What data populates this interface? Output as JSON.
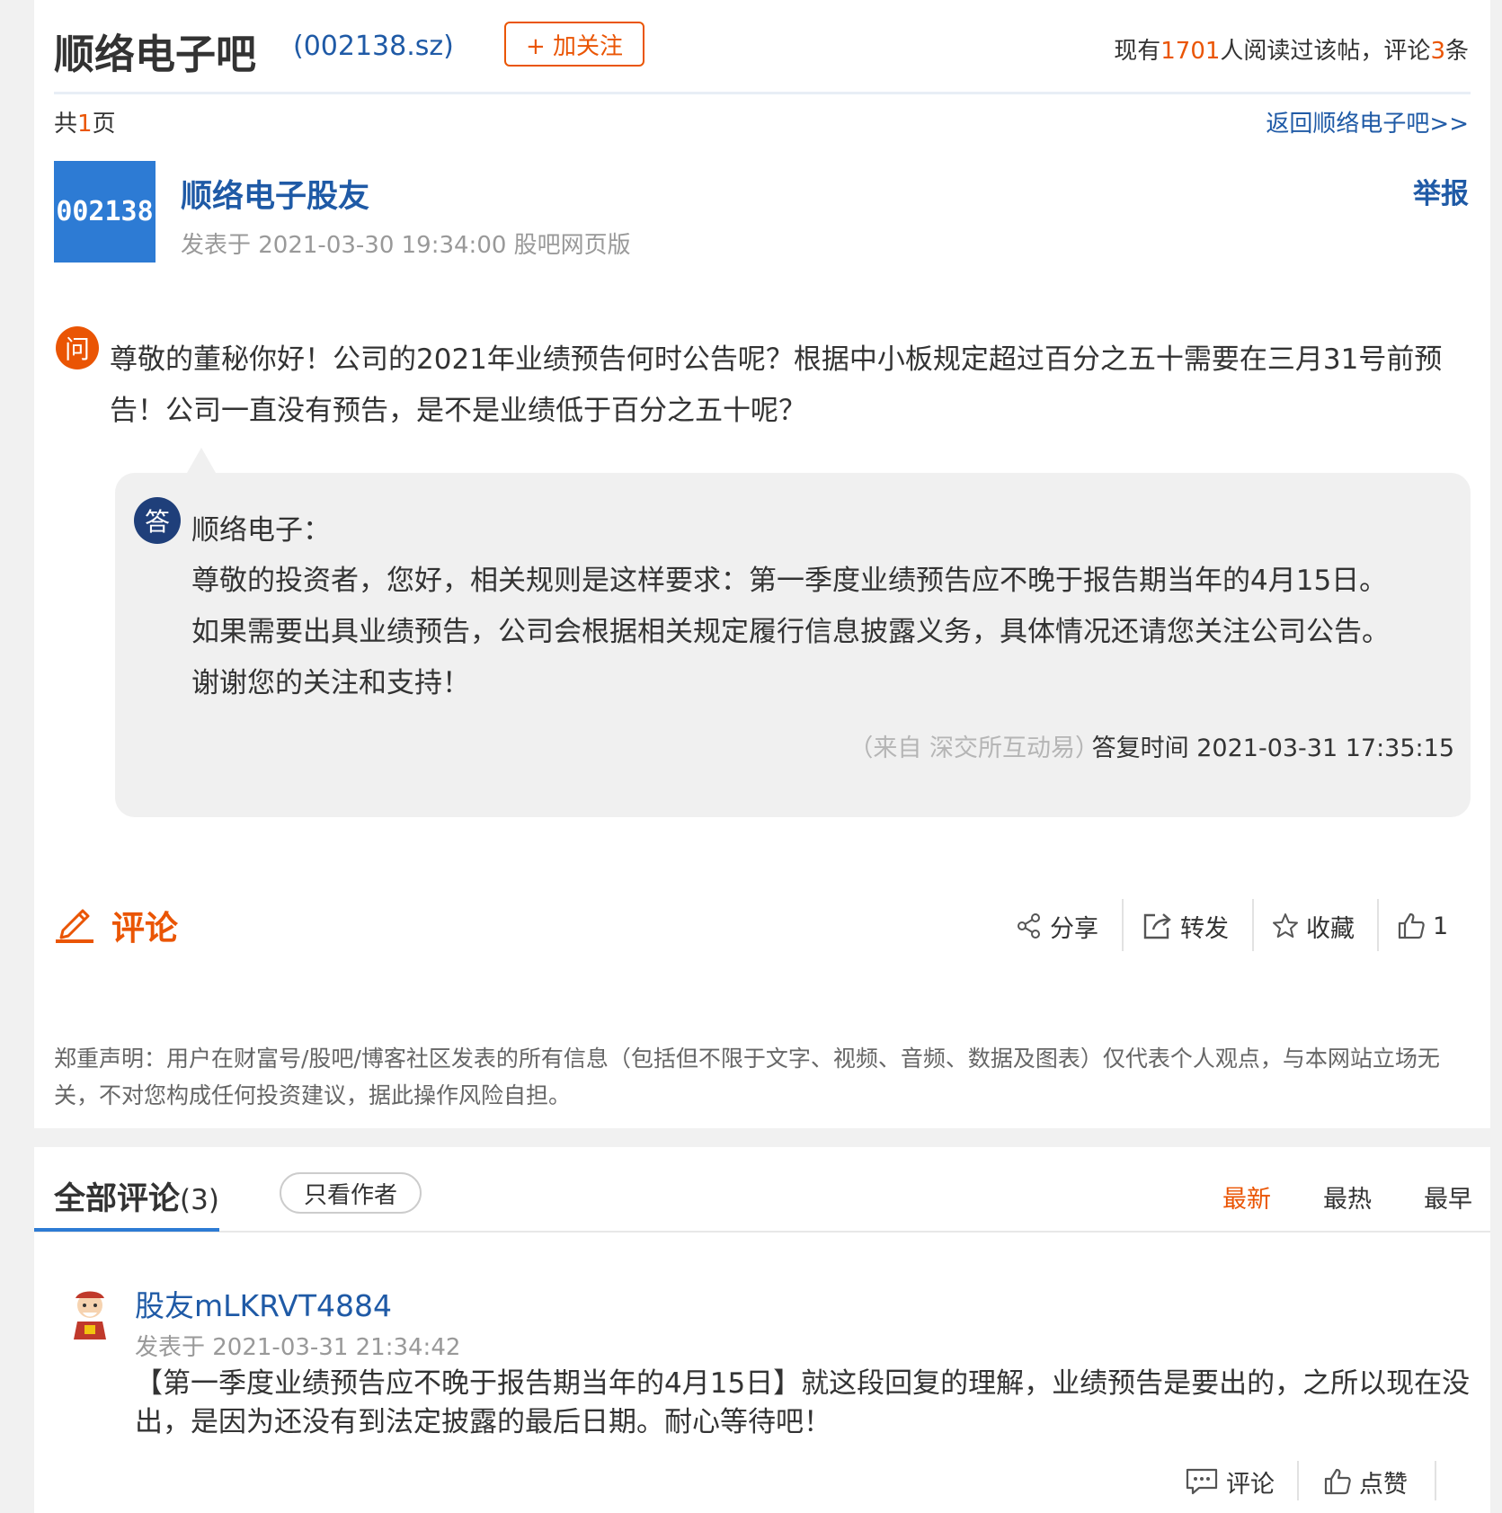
{
  "header": {
    "bar_name": "顺络电子吧",
    "stock_code": "(002138.sz)",
    "follow_label": "+ 加关注",
    "stats_prefix": "现有",
    "read_count": "1701",
    "stats_mid": "人阅读过该帖，评论",
    "comment_count": "3",
    "stats_suffix": "条"
  },
  "pager": {
    "prefix": "共",
    "page_count": "1",
    "suffix": "页",
    "back_link": "返回顺络电子吧>>"
  },
  "post": {
    "avatar_text": "002138",
    "author": "顺络电子股友",
    "meta": "发表于 2021-03-30 19:34:00 股吧网页版",
    "report_label": "举报",
    "question_icon": "问",
    "question": "尊敬的董秘你好！公司的2021年业绩预告何时公告呢？根据中小板规定超过百分之五十需要在三月31号前预告！公司一直没有预告，是不是业绩低于百分之五十呢？",
    "answer_icon": "答",
    "answer_name": "顺络电子：",
    "answer": "尊敬的投资者，您好，相关规则是这样要求：第一季度业绩预告应不晚于报告期当年的4月15日。如果需要出具业绩预告，公司会根据相关规定履行信息披露义务，具体情况还请您关注公司公告。谢谢您的关注和支持！",
    "answer_source": "（来自 深交所互动易）",
    "answer_time": "答复时间 2021-03-31 17:35:15"
  },
  "actions": {
    "comment_label": "评论",
    "share": "分享",
    "forward": "转发",
    "favorite": "收藏",
    "like_count": "1"
  },
  "disclaimer": "郑重声明：用户在财富号/股吧/博客社区发表的所有信息（包括但不限于文字、视频、音频、数据及图表）仅代表个人观点，与本网站立场无关，不对您构成任何投资建议，据此操作风险自担。",
  "comments_section": {
    "title": "全部评论",
    "count": "(3)",
    "author_only": "只看作者",
    "sort_new": "最新",
    "sort_hot": "最热",
    "sort_early": "最早"
  },
  "comments": [
    {
      "user": "股友mLKRVT4884",
      "meta": "发表于 2021-03-31 21:34:42",
      "text": "【第一季度业绩预告应不晚于报告期当年的4月15日】就这段回复的理解，业绩预告是要出的，之所以现在没出，是因为还没有到法定披露的最后日期。耐心等待吧！",
      "comment_label": "评论",
      "like_label": "点赞"
    }
  ],
  "colors": {
    "accent": "#ea5504",
    "link": "#1f5aa6",
    "avatar_bg": "#2d7bd4"
  }
}
